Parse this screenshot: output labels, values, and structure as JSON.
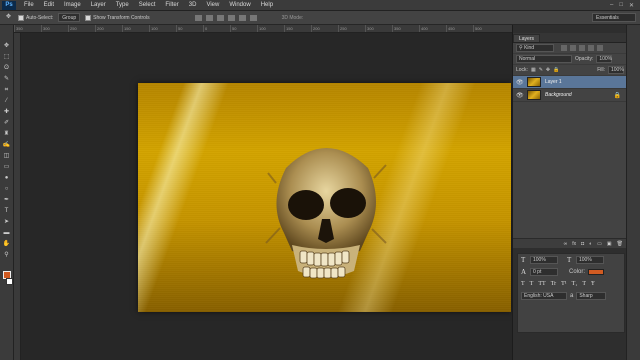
{
  "app": {
    "logo": "Ps"
  },
  "menu": [
    "File",
    "Edit",
    "Image",
    "Layer",
    "Type",
    "Select",
    "Filter",
    "3D",
    "View",
    "Window",
    "Help"
  ],
  "window_controls": [
    "–",
    "□",
    "✕"
  ],
  "options": {
    "auto_select_label": "Auto-Select:",
    "auto_select_value": "Group",
    "show_transform_label": "Show Transform Controls",
    "mode_3d_label": "3D Mode:",
    "workspace": "Essentials"
  },
  "ruler_ticks": [
    "350",
    "300",
    "250",
    "200",
    "150",
    "100",
    "50",
    "0",
    "50",
    "100",
    "150",
    "200",
    "250",
    "300",
    "350",
    "400",
    "450",
    "500"
  ],
  "tools": [
    "move-tool",
    "marquee-tool",
    "lasso-tool",
    "quick-select-tool",
    "crop-tool",
    "eyedropper-tool",
    "healing-tool",
    "brush-tool",
    "stamp-tool",
    "history-brush-tool",
    "eraser-tool",
    "gradient-tool",
    "blur-tool",
    "dodge-tool",
    "pen-tool",
    "type-tool",
    "path-select-tool",
    "shape-tool",
    "hand-tool",
    "zoom-tool"
  ],
  "tool_glyphs": [
    "✥",
    "⬚",
    "ʘ",
    "✎",
    "⌗",
    "⁄",
    "✚",
    "✐",
    "♜",
    "✍",
    "◫",
    "▭",
    "●",
    "○",
    "✒",
    "T",
    "➤",
    "▬",
    "✋",
    "⚲"
  ],
  "colors": {
    "foreground": "#d15b22",
    "background": "#ffffff"
  },
  "layers_panel": {
    "tab": "Layers",
    "kind": "Kind",
    "blend_mode": "Normal",
    "opacity_label": "Opacity:",
    "opacity_value": "100%",
    "lock_label": "Lock:",
    "fill_label": "Fill:",
    "fill_value": "100%",
    "layers": [
      {
        "name": "Layer 1",
        "selected": true
      },
      {
        "name": "Background",
        "selected": false
      }
    ],
    "footer_icons": [
      "link-icon",
      "fx-icon",
      "mask-icon",
      "adjustment-icon",
      "folder-icon",
      "new-layer-icon",
      "trash-icon"
    ],
    "footer_glyphs": [
      "∞",
      "fx",
      "◘",
      "◐",
      "▭",
      "▣",
      "🗑"
    ]
  },
  "character_panel": {
    "font_size": "100%",
    "tracking": "100%",
    "leading": "0 pt",
    "color_label": "Color:",
    "language": "English: USA",
    "antialias_label": "a",
    "antialias": "Sharp",
    "type_styles": [
      "T",
      "T",
      "TT",
      "Tr",
      "T¹",
      "T₁",
      "T",
      "Ŧ"
    ]
  }
}
